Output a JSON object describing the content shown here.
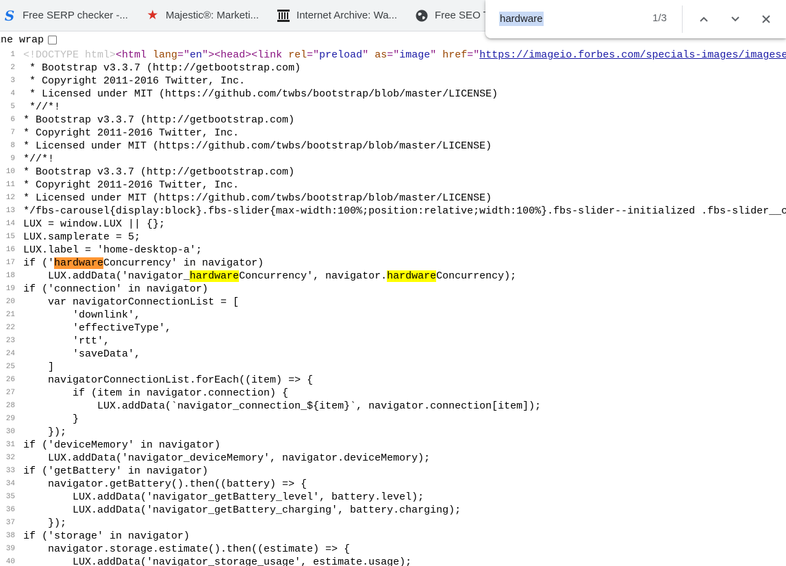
{
  "bookmarks": [
    {
      "label": "Free SERP checker -...",
      "icon": "serp-s-icon"
    },
    {
      "label": "Majestic®: Marketi...",
      "icon": "majestic-star-icon"
    },
    {
      "label": "Internet Archive: Wa...",
      "icon": "archive-building-icon"
    },
    {
      "label": "Free SEO Tools",
      "icon": "globe-icon"
    }
  ],
  "find": {
    "query": "hardware",
    "count": "1/3"
  },
  "wrap": {
    "label": "ine wrap"
  },
  "source_lines": [
    {
      "n": "1",
      "segs": [
        {
          "t": "<!DOCTYPE html>",
          "c": "doctype"
        },
        {
          "t": "<html ",
          "c": "tag"
        },
        {
          "t": "lang",
          "c": "attr"
        },
        {
          "t": "=\"",
          "c": "tag"
        },
        {
          "t": "en",
          "c": "val"
        },
        {
          "t": "\">",
          "c": "tag"
        },
        {
          "t": "<head>",
          "c": "tag"
        },
        {
          "t": "<link ",
          "c": "tag"
        },
        {
          "t": "rel",
          "c": "attr"
        },
        {
          "t": "=\"",
          "c": "tag"
        },
        {
          "t": "preload",
          "c": "val"
        },
        {
          "t": "\" ",
          "c": "tag"
        },
        {
          "t": "as",
          "c": "attr"
        },
        {
          "t": "=\"",
          "c": "tag"
        },
        {
          "t": "image",
          "c": "val"
        },
        {
          "t": "\" ",
          "c": "tag"
        },
        {
          "t": "href",
          "c": "attr"
        },
        {
          "t": "=\"",
          "c": "tag"
        },
        {
          "t": "https://imageio.forbes.com/specials-images/imageserve",
          "c": "link"
        }
      ]
    },
    {
      "n": "2",
      "segs": [
        {
          "t": " * Bootstrap v3.3.7 (http://getbootstrap.com)"
        }
      ]
    },
    {
      "n": "3",
      "segs": [
        {
          "t": " * Copyright 2011-2016 Twitter, Inc."
        }
      ]
    },
    {
      "n": "4",
      "segs": [
        {
          "t": " * Licensed under MIT (https://github.com/twbs/bootstrap/blob/master/LICENSE)"
        }
      ]
    },
    {
      "n": "5",
      "segs": [
        {
          "t": " *//*!"
        }
      ]
    },
    {
      "n": "6",
      "segs": [
        {
          "t": "* Bootstrap v3.3.7 (http://getbootstrap.com)"
        }
      ]
    },
    {
      "n": "7",
      "segs": [
        {
          "t": "* Copyright 2011-2016 Twitter, Inc."
        }
      ]
    },
    {
      "n": "8",
      "segs": [
        {
          "t": "* Licensed under MIT (https://github.com/twbs/bootstrap/blob/master/LICENSE)"
        }
      ]
    },
    {
      "n": "9",
      "segs": [
        {
          "t": "*//*!"
        }
      ]
    },
    {
      "n": "10",
      "segs": [
        {
          "t": "* Bootstrap v3.3.7 (http://getbootstrap.com)"
        }
      ]
    },
    {
      "n": "11",
      "segs": [
        {
          "t": "* Copyright 2011-2016 Twitter, Inc."
        }
      ]
    },
    {
      "n": "12",
      "segs": [
        {
          "t": "* Licensed under MIT (https://github.com/twbs/bootstrap/blob/master/LICENSE)"
        }
      ]
    },
    {
      "n": "13",
      "segs": [
        {
          "t": "*/fbs-carousel{display:block}.fbs-slider{max-width:100%;position:relative;width:100%}.fbs-slider--initialized .fbs-slider__cont"
        }
      ]
    },
    {
      "n": "14",
      "segs": [
        {
          "t": "LUX = window.LUX || {};"
        }
      ]
    },
    {
      "n": "15",
      "segs": [
        {
          "t": "LUX.samplerate = 5;"
        }
      ]
    },
    {
      "n": "16",
      "segs": [
        {
          "t": "LUX.label = 'home-desktop-a';"
        }
      ]
    },
    {
      "n": "17",
      "segs": [
        {
          "t": "if ('"
        },
        {
          "t": "hardware",
          "c": "hl-active"
        },
        {
          "t": "Concurrency' in navigator)"
        }
      ]
    },
    {
      "n": "18",
      "segs": [
        {
          "t": "    LUX.addData('navigator_"
        },
        {
          "t": "hardware",
          "c": "hl"
        },
        {
          "t": "Concurrency', navigator."
        },
        {
          "t": "hardware",
          "c": "hl"
        },
        {
          "t": "Concurrency);"
        }
      ]
    },
    {
      "n": "19",
      "segs": [
        {
          "t": "if ('connection' in navigator)"
        }
      ]
    },
    {
      "n": "20",
      "segs": [
        {
          "t": "    var navigatorConnectionList = ["
        }
      ]
    },
    {
      "n": "21",
      "segs": [
        {
          "t": "        'downlink',"
        }
      ]
    },
    {
      "n": "22",
      "segs": [
        {
          "t": "        'effectiveType',"
        }
      ]
    },
    {
      "n": "23",
      "segs": [
        {
          "t": "        'rtt',"
        }
      ]
    },
    {
      "n": "24",
      "segs": [
        {
          "t": "        'saveData',"
        }
      ]
    },
    {
      "n": "25",
      "segs": [
        {
          "t": "    ]"
        }
      ]
    },
    {
      "n": "26",
      "segs": [
        {
          "t": "    navigatorConnectionList.forEach((item) => {"
        }
      ]
    },
    {
      "n": "27",
      "segs": [
        {
          "t": "        if (item in navigator.connection) {"
        }
      ]
    },
    {
      "n": "28",
      "segs": [
        {
          "t": "            LUX.addData(`navigator_connection_${item}`, navigator.connection[item]);"
        }
      ]
    },
    {
      "n": "29",
      "segs": [
        {
          "t": "        }"
        }
      ]
    },
    {
      "n": "30",
      "segs": [
        {
          "t": "    });"
        }
      ]
    },
    {
      "n": "31",
      "segs": [
        {
          "t": "if ('deviceMemory' in navigator)"
        }
      ]
    },
    {
      "n": "32",
      "segs": [
        {
          "t": "    LUX.addData('navigator_deviceMemory', navigator.deviceMemory);"
        }
      ]
    },
    {
      "n": "33",
      "segs": [
        {
          "t": "if ('getBattery' in navigator)"
        }
      ]
    },
    {
      "n": "34",
      "segs": [
        {
          "t": "    navigator.getBattery().then((battery) => {"
        }
      ]
    },
    {
      "n": "35",
      "segs": [
        {
          "t": "        LUX.addData('navigator_getBattery_level', battery.level);"
        }
      ]
    },
    {
      "n": "36",
      "segs": [
        {
          "t": "        LUX.addData('navigator_getBattery_charging', battery.charging);"
        }
      ]
    },
    {
      "n": "37",
      "segs": [
        {
          "t": "    });"
        }
      ]
    },
    {
      "n": "38",
      "segs": [
        {
          "t": "if ('storage' in navigator)"
        }
      ]
    },
    {
      "n": "39",
      "segs": [
        {
          "t": "    navigator.storage.estimate().then((estimate) => {"
        }
      ]
    },
    {
      "n": "40",
      "segs": [
        {
          "t": "        LUX.addData('navigator_storage_usage', estimate.usage);"
        }
      ]
    }
  ]
}
